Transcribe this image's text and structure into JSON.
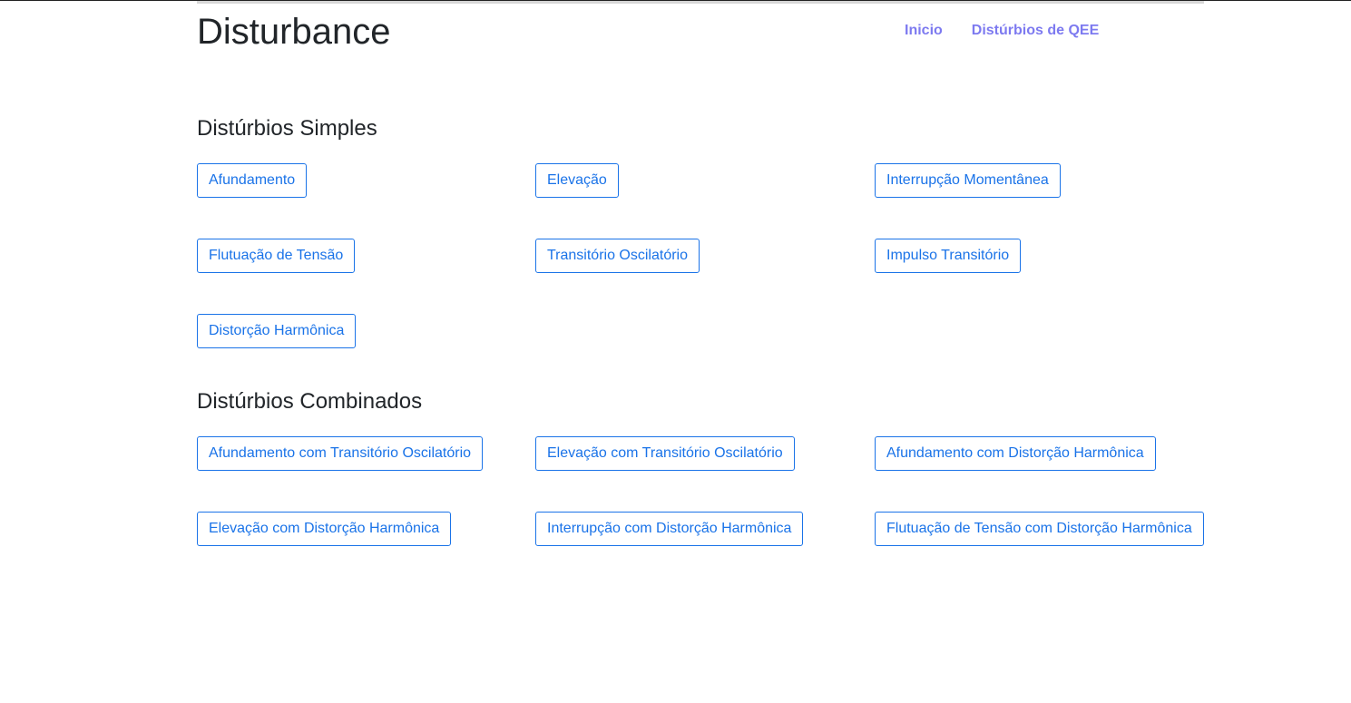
{
  "header": {
    "brand": "Disturbance",
    "nav": [
      {
        "label": "Inicio"
      },
      {
        "label": "Distúrbios de QEE"
      }
    ]
  },
  "simple": {
    "title": "Distúrbios Simples",
    "rows": [
      [
        "Afundamento",
        "Elevação",
        "Interrupção Momentânea"
      ],
      [
        "Flutuação de Tensão",
        "Transitório Oscilatório",
        "Impulso Transitório"
      ],
      [
        "Distorção Harmônica"
      ]
    ]
  },
  "combined": {
    "title": "Distúrbios Combinados",
    "rows": [
      [
        "Afundamento com Transitório Oscilatório",
        "Elevação com Transitório Oscilatório",
        "Afundamento com Distorção Harmônica"
      ],
      [
        "Elevação com Distorção Harmônica",
        "Interrupção com Distorção Harmônica",
        "Flutuação de Tensão com Distorção Harmônica"
      ]
    ]
  },
  "colors": {
    "nav_link": "#7d7af0",
    "button_outline": "#1a73e8",
    "text": "#212529"
  }
}
